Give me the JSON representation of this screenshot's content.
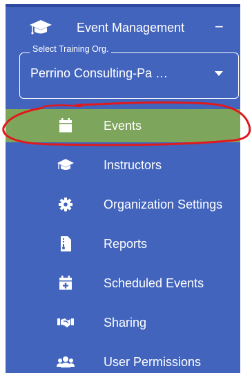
{
  "header": {
    "title": "Event Management",
    "collapse_symbol": "−",
    "icon": "graduation-cap-icon"
  },
  "org_select": {
    "legend": "Select Training Org.",
    "value": "Perrino Consulting-Pa  …"
  },
  "nav": {
    "items": [
      {
        "label": "Events",
        "icon": "calendar-icon",
        "active": true
      },
      {
        "label": "Instructors",
        "icon": "graduation-cap-icon",
        "active": false
      },
      {
        "label": "Organization Settings",
        "icon": "gear-icon",
        "active": false
      },
      {
        "label": "Reports",
        "icon": "report-file-icon",
        "active": false
      },
      {
        "label": "Scheduled Events",
        "icon": "calendar-plus-icon",
        "active": false
      },
      {
        "label": "Sharing",
        "icon": "handshake-icon",
        "active": false
      },
      {
        "label": "User Permissions",
        "icon": "users-icon",
        "active": false
      }
    ]
  },
  "colors": {
    "sidebar": "#4264bd",
    "active_item": "#7ea55c",
    "annotation": "#e0191c",
    "text": "#ffffff"
  }
}
